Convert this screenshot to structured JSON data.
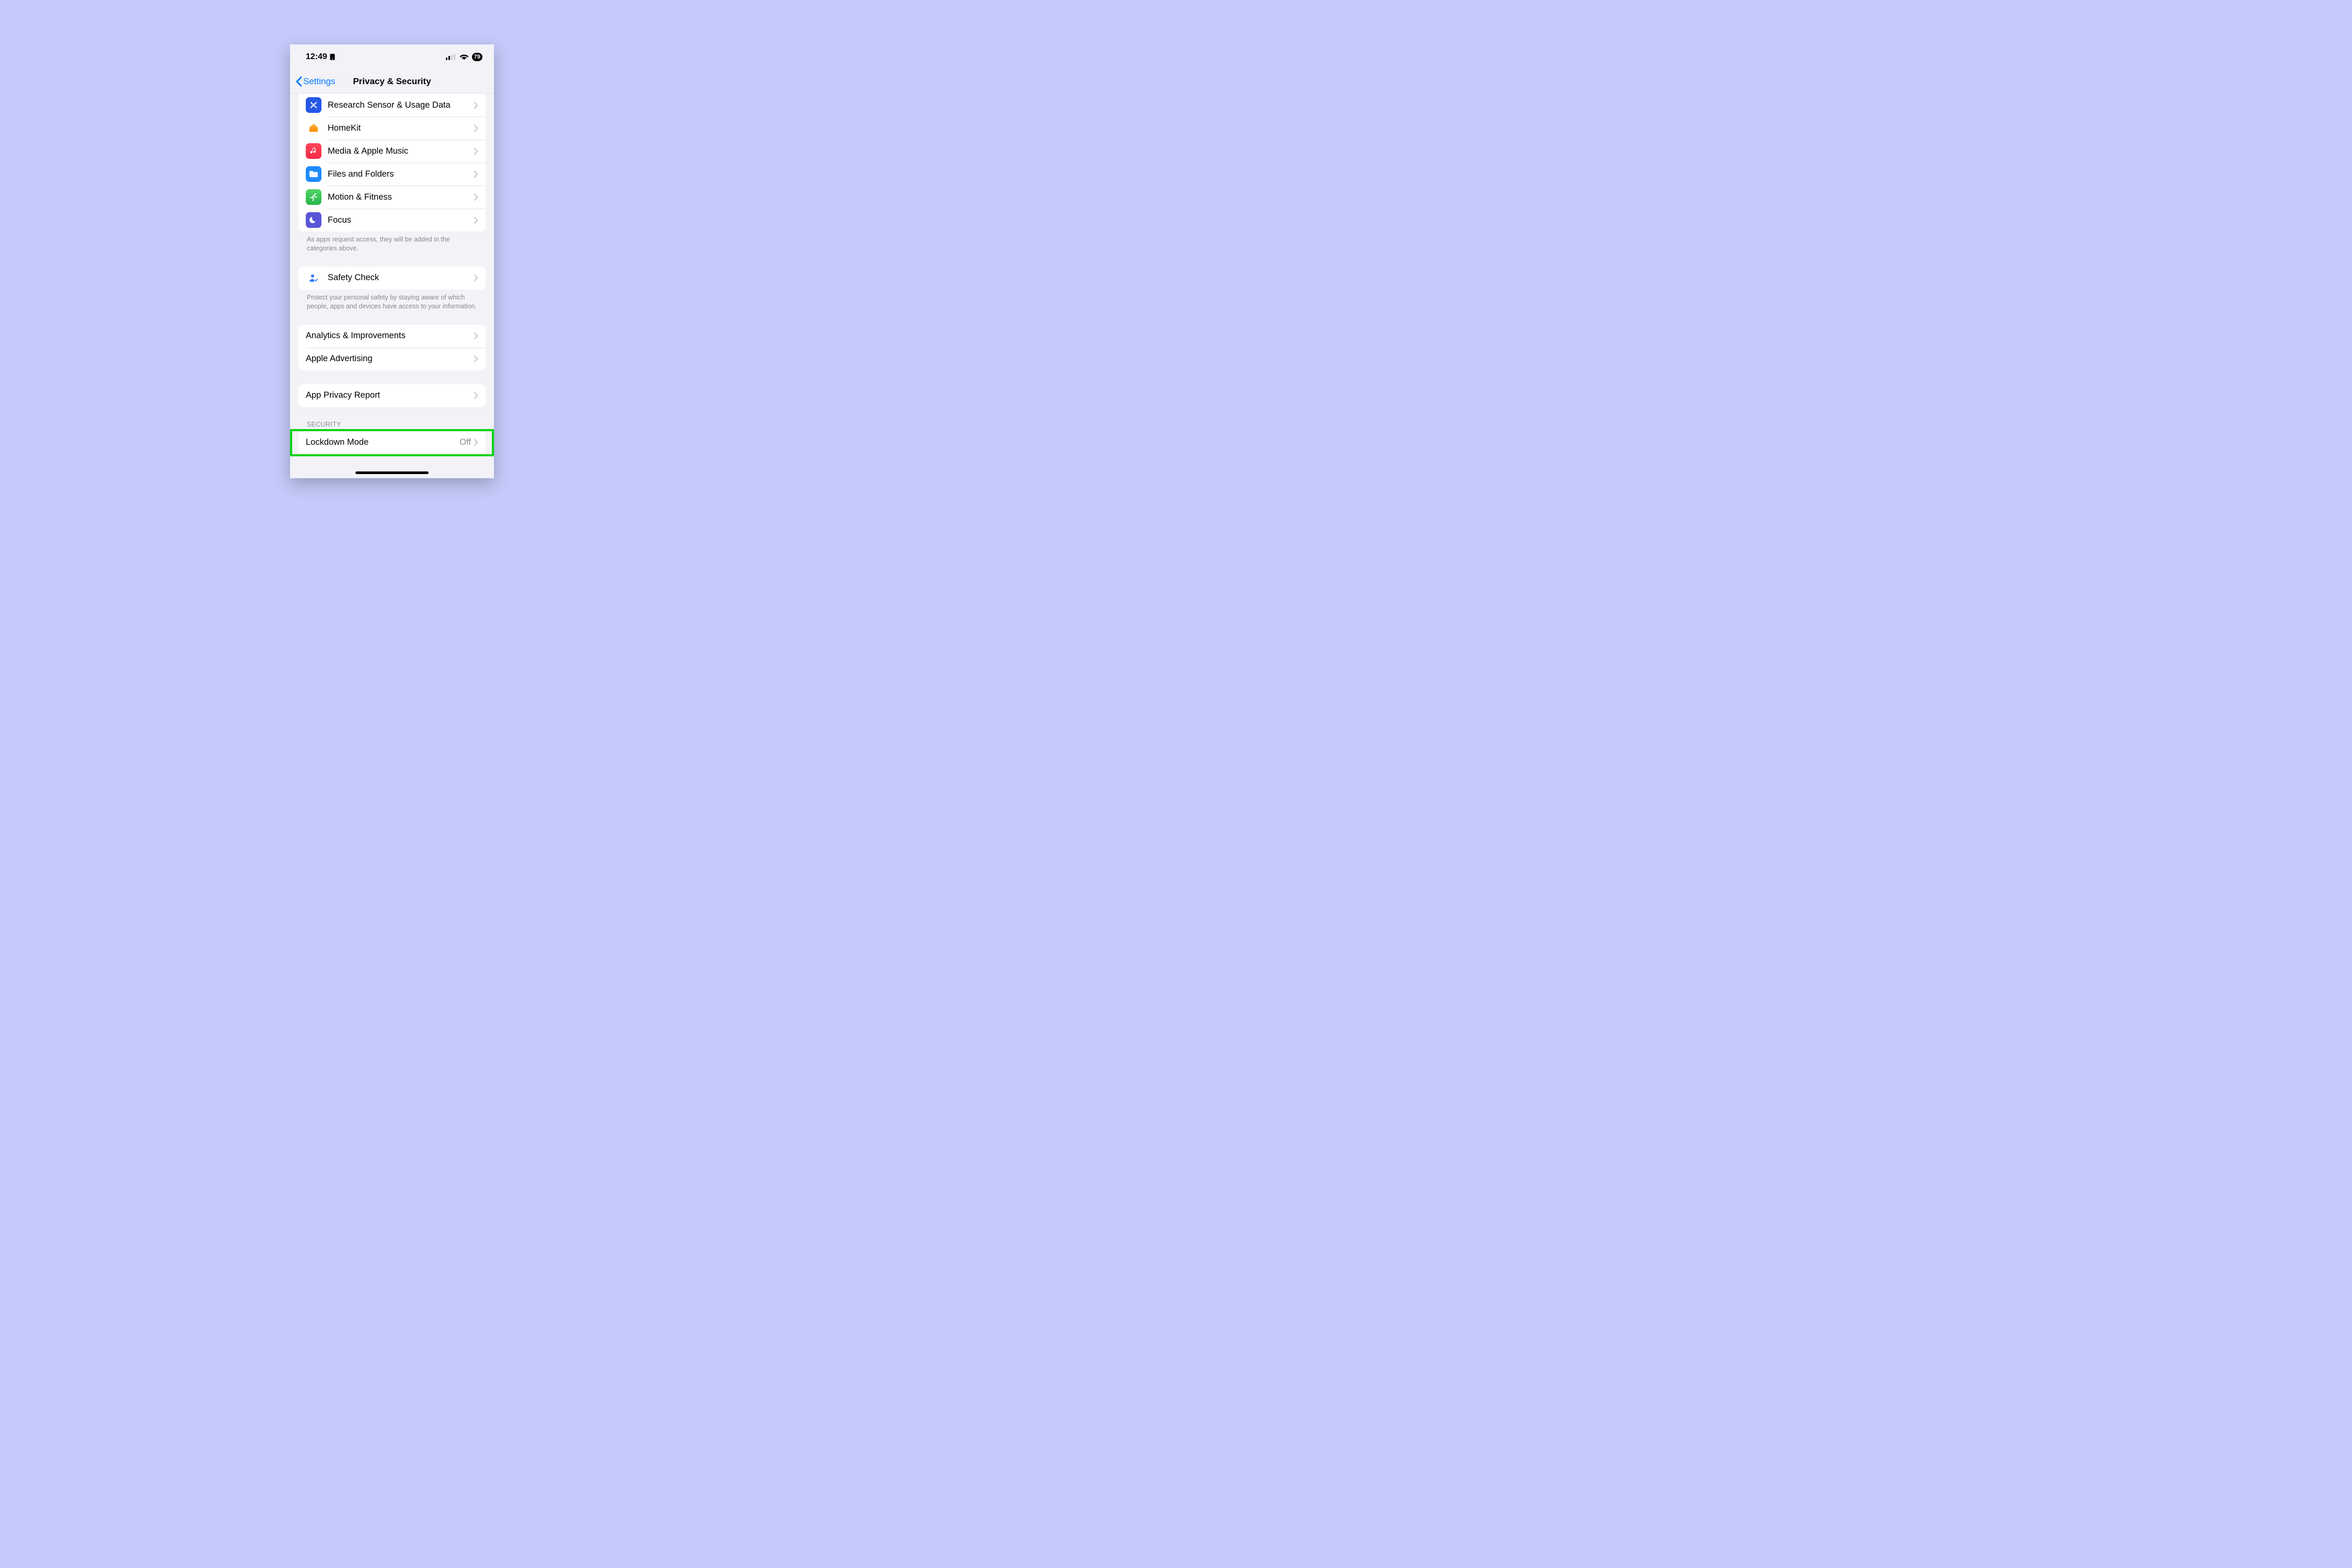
{
  "status": {
    "time": "12:49",
    "battery": "79"
  },
  "nav": {
    "back": "Settings",
    "title": "Privacy & Security"
  },
  "group1": {
    "research": "Research Sensor & Usage Data",
    "homekit": "HomeKit",
    "media": "Media & Apple Music",
    "files": "Files and Folders",
    "motion": "Motion & Fitness",
    "focus": "Focus",
    "footer": "As apps request access, they will be added in the categories above."
  },
  "group2": {
    "safety": "Safety Check",
    "footer": "Protect your personal safety by staying aware of which people, apps and devices have access to your information."
  },
  "group3": {
    "analytics": "Analytics & Improvements",
    "ads": "Apple Advertising"
  },
  "group4": {
    "report": "App Privacy Report"
  },
  "security": {
    "header": "Security",
    "lockdown_label": "Lockdown Mode",
    "lockdown_value": "Off"
  }
}
